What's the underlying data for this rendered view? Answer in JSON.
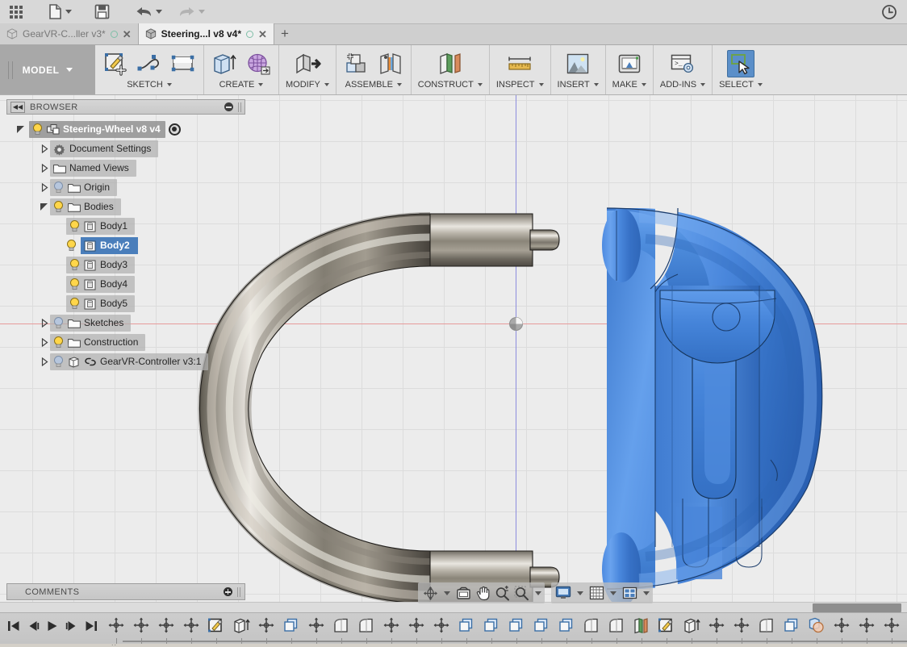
{
  "app": {
    "title": "Autodesk Fusion 360",
    "accent": "#4a7ebb",
    "canvas_bg": "#ececec",
    "grid_color": "#dcdcdc",
    "axis_x_color": "#e79a9a",
    "axis_y_color": "#8c8cdd"
  },
  "quick_access": {
    "items": [
      {
        "name": "app-grid",
        "icon": "grid-icon",
        "label": "Show Data Panel"
      },
      {
        "name": "file",
        "icon": "file-icon",
        "label": "File",
        "has_dropdown": true
      },
      {
        "name": "save",
        "icon": "save-icon",
        "label": "Save"
      },
      {
        "name": "undo",
        "icon": "undo-icon",
        "label": "Undo",
        "has_dropdown": true
      },
      {
        "name": "redo",
        "icon": "redo-icon",
        "label": "Redo",
        "has_dropdown": true
      }
    ],
    "clock_label": "Job Status"
  },
  "tabs": {
    "items": [
      {
        "label": "GearVR-C...ller v3*",
        "active": false
      },
      {
        "label": "Steering...l v8 v4*",
        "active": true
      }
    ],
    "add_label": "+"
  },
  "ribbon": {
    "workspace": {
      "label": "MODEL",
      "has_dropdown": true
    },
    "panels": [
      {
        "label": "SKETCH",
        "has_dropdown": true,
        "icons": [
          {
            "name": "create-sketch-icon",
            "label": "Create Sketch"
          },
          {
            "name": "spline-icon",
            "label": "Spline"
          },
          {
            "name": "rectangle-icon",
            "label": "Rectangle"
          }
        ]
      },
      {
        "label": "CREATE",
        "has_dropdown": true,
        "icons": [
          {
            "name": "extrude-icon",
            "label": "Extrude"
          },
          {
            "name": "mesh-icon",
            "label": "Create Form"
          }
        ]
      },
      {
        "label": "MODIFY",
        "has_dropdown": true,
        "icons": [
          {
            "name": "press-pull-icon",
            "label": "Press Pull"
          }
        ]
      },
      {
        "label": "ASSEMBLE",
        "has_dropdown": true,
        "icons": [
          {
            "name": "new-component-icon",
            "label": "New Component"
          },
          {
            "name": "joint-icon",
            "label": "Joint"
          }
        ]
      },
      {
        "label": "CONSTRUCT",
        "has_dropdown": true,
        "icons": [
          {
            "name": "offset-plane-icon",
            "label": "Offset Plane"
          }
        ]
      },
      {
        "label": "INSPECT",
        "has_dropdown": true,
        "icons": [
          {
            "name": "measure-icon",
            "label": "Measure"
          }
        ]
      },
      {
        "label": "INSERT",
        "has_dropdown": true,
        "icons": [
          {
            "name": "insert-image-icon",
            "label": "Insert Canvas"
          }
        ]
      },
      {
        "label": "MAKE",
        "has_dropdown": true,
        "icons": [
          {
            "name": "3d-print-icon",
            "label": "3D Print"
          }
        ]
      },
      {
        "label": "ADD-INS",
        "has_dropdown": true,
        "icons": [
          {
            "name": "scripts-addins-icon",
            "label": "Scripts and Add-Ins"
          }
        ]
      },
      {
        "label": "SELECT",
        "has_dropdown": true,
        "selected": true,
        "icons": [
          {
            "name": "select-cursor-icon",
            "label": "Select",
            "active": true
          }
        ]
      }
    ]
  },
  "browser": {
    "header": "BROWSER",
    "collapse_label": "Collapse",
    "tree": [
      {
        "label": "Steering-Wheel v8 v4",
        "depth": 0,
        "arrow": "open",
        "bulb": "on",
        "icon": "component-icon",
        "root": true,
        "activate_radio": true
      },
      {
        "label": "Document Settings",
        "depth": 1,
        "arrow": "closed",
        "bulb": "none",
        "icon": "gear-icon"
      },
      {
        "label": "Named Views",
        "depth": 1,
        "arrow": "closed",
        "bulb": "none",
        "icon": "folder-icon"
      },
      {
        "label": "Origin",
        "depth": 1,
        "arrow": "closed",
        "bulb": "off",
        "icon": "folder-icon"
      },
      {
        "label": "Bodies",
        "depth": 1,
        "arrow": "open",
        "bulb": "on",
        "icon": "folder-icon"
      },
      {
        "label": "Body1",
        "depth": 2,
        "arrow": "none",
        "bulb": "on",
        "icon": "body-icon"
      },
      {
        "label": "Body2",
        "depth": 2,
        "arrow": "none",
        "bulb": "on",
        "icon": "body-icon",
        "selected": true
      },
      {
        "label": "Body3",
        "depth": 2,
        "arrow": "none",
        "bulb": "on",
        "icon": "body-icon"
      },
      {
        "label": "Body4",
        "depth": 2,
        "arrow": "none",
        "bulb": "on",
        "icon": "body-icon"
      },
      {
        "label": "Body5",
        "depth": 2,
        "arrow": "none",
        "bulb": "on",
        "icon": "body-icon"
      },
      {
        "label": "Sketches",
        "depth": 1,
        "arrow": "closed",
        "bulb": "off",
        "icon": "folder-icon"
      },
      {
        "label": "Construction",
        "depth": 1,
        "arrow": "closed",
        "bulb": "on",
        "icon": "folder-icon"
      },
      {
        "label": "GearVR-Controller v3:1",
        "depth": 1,
        "arrow": "closed",
        "bulb": "off",
        "icon": "component-icon",
        "link": true
      }
    ]
  },
  "viewbar": {
    "group1": [
      {
        "name": "orbit-icon",
        "label": "Orbit",
        "has_dropdown": true
      },
      {
        "name": "look-at-icon",
        "label": "Look At"
      },
      {
        "name": "pan-icon",
        "label": "Pan"
      },
      {
        "name": "zoom-icon",
        "label": "Zoom"
      },
      {
        "name": "fit-icon",
        "label": "Fit",
        "has_dropdown": true
      }
    ],
    "group2": [
      {
        "name": "display-settings-icon",
        "label": "Display Settings",
        "has_dropdown": true
      },
      {
        "name": "grid-snaps-icon",
        "label": "Grid and Snaps",
        "has_dropdown": true
      },
      {
        "name": "viewports-icon",
        "label": "Viewports",
        "has_dropdown": true
      }
    ]
  },
  "comments": {
    "label": "COMMENTS",
    "add_label": "Add comment"
  },
  "timeline": {
    "playback": [
      {
        "name": "timeline-start-icon",
        "label": "Go to beginning"
      },
      {
        "name": "timeline-step-back-icon",
        "label": "Step back"
      },
      {
        "name": "timeline-play-icon",
        "label": "Play"
      },
      {
        "name": "timeline-step-forward-icon",
        "label": "Step forward"
      },
      {
        "name": "timeline-end-icon",
        "label": "Go to end"
      }
    ],
    "features": [
      {
        "name": "move-feature-icon",
        "type": "move"
      },
      {
        "name": "move-feature-icon",
        "type": "move"
      },
      {
        "name": "move-feature-icon",
        "type": "move"
      },
      {
        "name": "move-feature-icon",
        "type": "move"
      },
      {
        "name": "sketch-feature-icon",
        "type": "sketch"
      },
      {
        "name": "extrude-feature-icon",
        "type": "extrude"
      },
      {
        "name": "move-feature-icon",
        "type": "move"
      },
      {
        "name": "pattern-feature-icon",
        "type": "pattern"
      },
      {
        "name": "move-feature-icon",
        "type": "move"
      },
      {
        "name": "fillet-feature-icon",
        "type": "fillet"
      },
      {
        "name": "fillet-feature-icon",
        "type": "fillet"
      },
      {
        "name": "move-feature-icon",
        "type": "move"
      },
      {
        "name": "move-feature-icon",
        "type": "move"
      },
      {
        "name": "move-feature-icon",
        "type": "move"
      },
      {
        "name": "pattern-feature-icon",
        "type": "pattern"
      },
      {
        "name": "pattern-feature-icon",
        "type": "pattern"
      },
      {
        "name": "pattern-feature-icon",
        "type": "pattern"
      },
      {
        "name": "pattern-feature-icon",
        "type": "pattern"
      },
      {
        "name": "pattern-feature-icon",
        "type": "pattern"
      },
      {
        "name": "fillet-feature-icon",
        "type": "fillet"
      },
      {
        "name": "fillet-feature-icon",
        "type": "fillet"
      },
      {
        "name": "construct-feature-icon",
        "type": "construct"
      },
      {
        "name": "sketch-feature-icon",
        "type": "sketch"
      },
      {
        "name": "extrude-feature-icon",
        "type": "extrude"
      },
      {
        "name": "move-feature-icon",
        "type": "move"
      },
      {
        "name": "move-feature-icon",
        "type": "move"
      },
      {
        "name": "fillet-feature-icon",
        "type": "fillet"
      },
      {
        "name": "pattern-feature-icon",
        "type": "pattern"
      },
      {
        "name": "combine-feature-icon",
        "type": "combine"
      },
      {
        "name": "move-feature-icon",
        "type": "move"
      },
      {
        "name": "move-feature-icon",
        "type": "move"
      },
      {
        "name": "move-feature-icon",
        "type": "move"
      },
      {
        "name": "sketch-feature-icon",
        "type": "sketch"
      },
      {
        "name": "extrude-feature-icon",
        "type": "extrude"
      },
      {
        "name": "combine-feature-icon",
        "type": "combine"
      },
      {
        "name": "move-feature-icon",
        "type": "move"
      },
      {
        "name": "fillet-feature-icon",
        "type": "fillet"
      },
      {
        "name": "pattern-feature-icon",
        "type": "pattern"
      },
      {
        "name": "move-feature-icon",
        "type": "move"
      },
      {
        "name": "combine-feature-icon",
        "type": "combine"
      },
      {
        "name": "shell-feature-icon",
        "type": "shell"
      },
      {
        "name": "fillet-feature-icon",
        "type": "fillet"
      }
    ],
    "end_marker": "timeline-end-marker-icon",
    "leading_dots": ".."
  },
  "model": {
    "parts": [
      {
        "name": "steering-wheel-metal-ring",
        "material": "brushed-metal",
        "color": "#9b9487"
      },
      {
        "name": "gearvr-controller-mount",
        "material": "plastic",
        "color": "#3f7ed4"
      }
    ]
  }
}
